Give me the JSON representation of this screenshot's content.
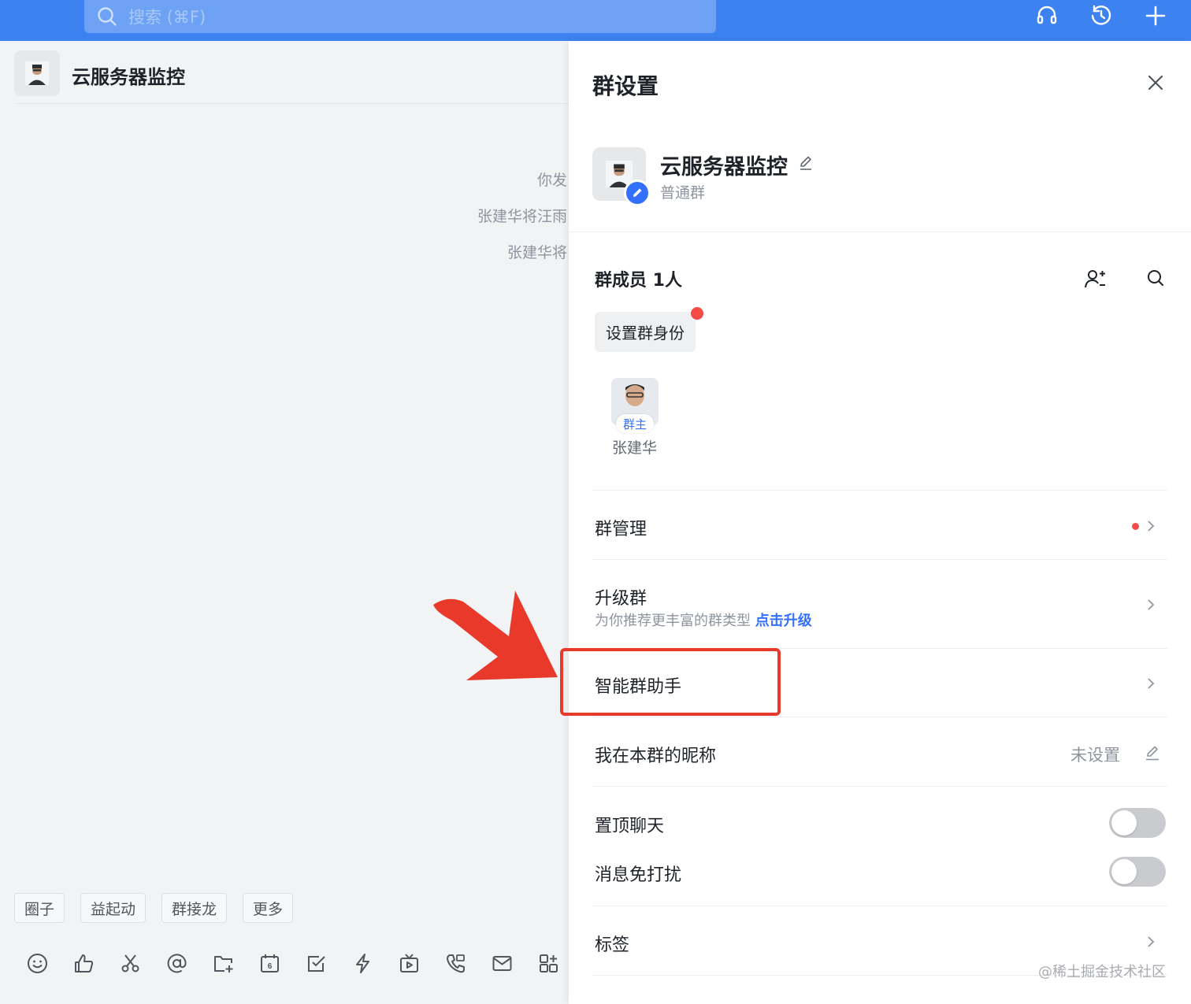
{
  "topbar": {
    "search_placeholder": "搜索 (⌘F)",
    "icons": [
      "headset-icon",
      "history-icon",
      "plus-icon"
    ],
    "color": "#3c82f0"
  },
  "chat": {
    "title": "云服务器监控",
    "system_messages": [
      "你发",
      "张建华将汪雨",
      "张建华将"
    ],
    "quick_tags": [
      "圈子",
      "益起动",
      "群接龙",
      "更多"
    ],
    "toolbar_icons": [
      "emoji-icon",
      "thumbs-up-icon",
      "scissors-icon",
      "at-icon",
      "folder-plus-icon",
      "calendar-icon",
      "checkbox-icon",
      "lightning-icon",
      "video-icon",
      "phone-icon",
      "mail-icon",
      "layout-icon"
    ],
    "calendar_day": "6"
  },
  "panel": {
    "title": "群设置",
    "group": {
      "name": "云服务器监控",
      "type": "普通群"
    },
    "members": {
      "title": "群成员 1人",
      "set_identity": "设置群身份",
      "list": [
        {
          "name": "张建华",
          "badge": "群主"
        }
      ]
    },
    "rows": {
      "management": "群管理",
      "upgrade": {
        "label": "升级群",
        "sub": "为你推荐更丰富的群类型",
        "link": "点击升级"
      },
      "assistant": "智能群助手",
      "nickname": {
        "label": "我在本群的昵称",
        "value": "未设置"
      },
      "pin_chat": {
        "label": "置顶聊天",
        "on": false
      },
      "mute": {
        "label": "消息免打扰",
        "on": false
      },
      "tags": "标签"
    },
    "accent_color": "#3370ff",
    "alert_color": "#f54a45"
  },
  "annotation": {
    "highlight_color": "#e8392b"
  },
  "watermark": "@稀土掘金技术社区"
}
